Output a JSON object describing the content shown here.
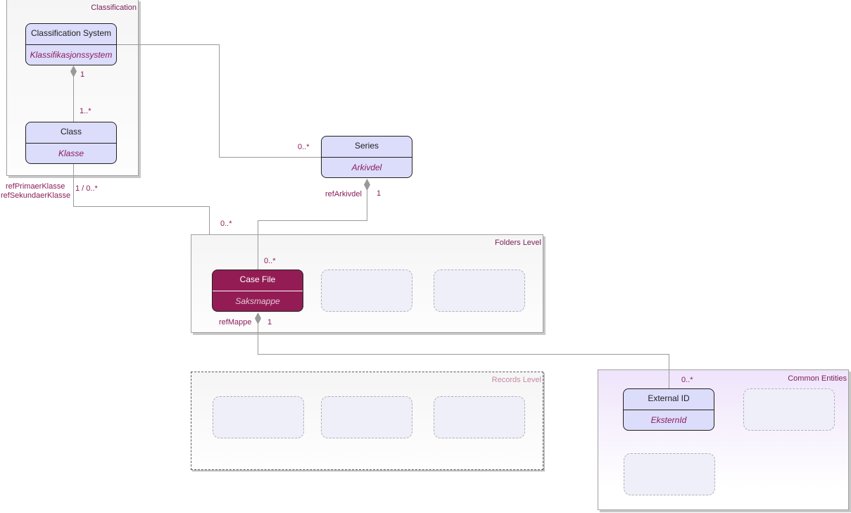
{
  "groups": {
    "classification": "Classification",
    "folders": "Folders Level",
    "records": "Records Level",
    "common": "Common Entities"
  },
  "classes": {
    "classification_system": {
      "name": "Classification System",
      "alias": "Klassifikasjonssystem"
    },
    "class": {
      "name": "Class",
      "alias": "Klasse"
    },
    "series": {
      "name": "Series",
      "alias": "Arkivdel"
    },
    "case_file": {
      "name": "Case File",
      "alias": "Saksmappe"
    },
    "external_id": {
      "name": "External ID",
      "alias": "EksternId"
    }
  },
  "associations": {
    "system_class": {
      "source_mult": "1",
      "target_mult": "1..*"
    },
    "system_series": {
      "target_mult": "0..*"
    },
    "class_casefile": {
      "role": "refPrimaerKlasse\nrefSekundaerKlasse",
      "role_1": "refPrimaerKlasse",
      "role_2": "refSekundaerKlasse",
      "source_mult": "1 / 0..*",
      "target_mult": "0..*"
    },
    "series_casefile": {
      "role": "refArkivdel",
      "source_mult": "1",
      "target_mult": "0..*"
    },
    "casefile_externalid": {
      "role": "refMappe",
      "source_mult": "1",
      "target_mult": "0..*"
    }
  },
  "colors": {
    "class_fill": "#dcdcfb",
    "highlight_fill": "#941c54",
    "label": "#8b1d5a",
    "connector": "#9a9a9a"
  }
}
